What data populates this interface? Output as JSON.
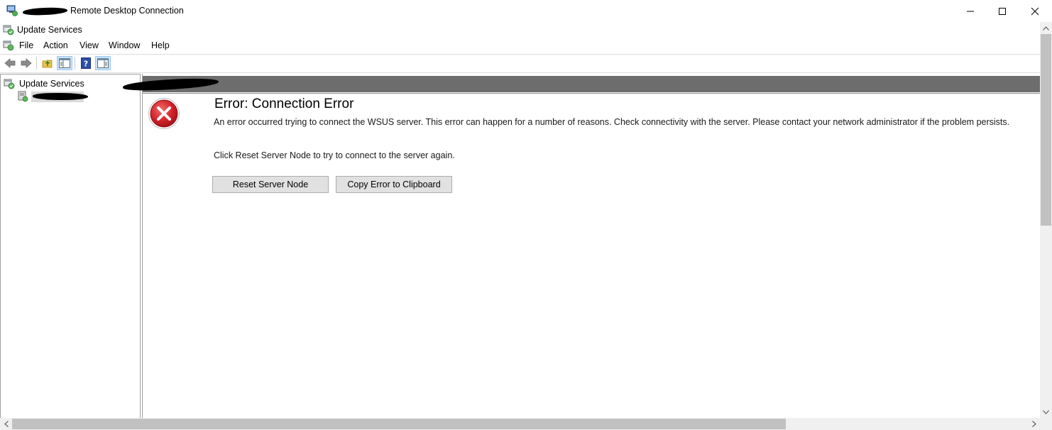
{
  "rdp": {
    "title": "Remote Desktop Connection",
    "controls": {
      "minimize": "—",
      "maximize": "☐",
      "close": "✕"
    }
  },
  "mmc": {
    "title": "Update Services"
  },
  "menu": {
    "file": "File",
    "action": "Action",
    "view": "View",
    "window": "Window",
    "help": "Help"
  },
  "toolbar": {
    "help_glyph": "?"
  },
  "tree": {
    "root_label": "Update Services"
  },
  "result": {
    "error_title": "Error: Connection Error",
    "error_description": "An error occurred trying to connect the WSUS server. This error can happen for a number of reasons. Check connectivity with the server. Please contact your network administrator if the problem persists.",
    "reset_hint": "Click Reset Server Node to try to connect to the server again.",
    "reset_button": "Reset Server Node",
    "copy_button": "Copy Error to Clipboard"
  },
  "icons": {
    "error": "error-icon",
    "back": "back-arrow-icon",
    "forward": "forward-arrow-icon",
    "up": "up-folder-icon",
    "show_hide": "show-hide-tree-icon",
    "help": "help-icon"
  },
  "colors": {
    "header_bar": "#6d6d6d",
    "error_red": "#d2222a",
    "pressed_blue": "#cce4f7",
    "button_face": "#e1e1e1"
  }
}
